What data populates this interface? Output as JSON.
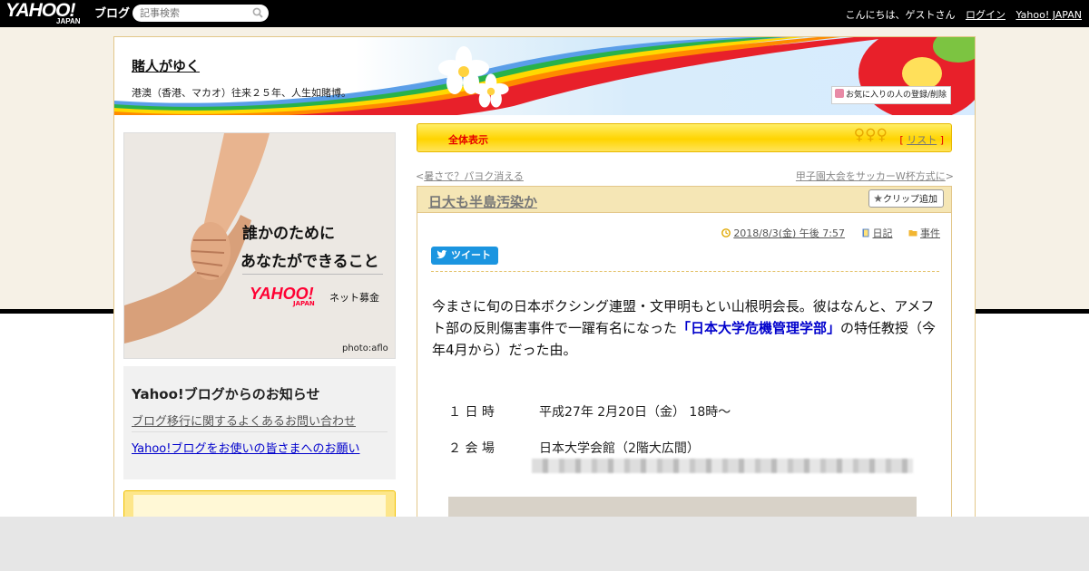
{
  "topbar": {
    "logo": "YAHOO!",
    "logo_sub": "JAPAN",
    "service": "ブログ",
    "search_placeholder": "記事検索",
    "greeting": "こんにちは、ゲストさん",
    "login": "ログイン",
    "yahoo_japan": "Yahoo! JAPAN"
  },
  "blog": {
    "title": "賭人がゆく",
    "description": "港澳（香港、マカオ）往来２５年、人生如賭博。",
    "favorite_button": "お気に入りの人の登録/削除"
  },
  "ad": {
    "line1": "誰かのために",
    "line2": "あなたができること",
    "logo": "YAHOO!",
    "logo_sub": "JAPAN",
    "service": "ネット募金",
    "credit": "photo:aflo"
  },
  "notice": {
    "title": "Yahoo!ブログからのお知らせ",
    "link1": "ブログ移行に関するよくあるお問い合わせ",
    "link2": "Yahoo!ブログをお使いの皆さまへのお願い"
  },
  "nav": {
    "show_all": "全体表示",
    "list_open": "[",
    "list": "リスト",
    "list_close": "]",
    "prev_arrow": "<",
    "prev": "暑さで？パヨク消える",
    "next": "甲子園大会をサッカーW杯方式に",
    "next_arrow": ">"
  },
  "article": {
    "title": "日大も半島汚染か",
    "clip_button": "クリップ追加",
    "date": "2018/8/3(金) 午後 7:57",
    "category1": "日記",
    "category2": "事件",
    "tweet": "ツイート",
    "body_part1": "今まさに旬の日本ボクシング連盟・文甲明もとい山根明会長。彼はなんと、アメフト部の反則傷害事件で一躍有名になった",
    "body_emphasis": "「日本大学危機管理学部」",
    "body_part2": "の特任教授（今年4月から）だった由。",
    "image_row1_label": "１ 日 時",
    "image_row1_value": "平成27年  2月20日（金）  18時〜",
    "image_row2_label": "２ 会 場",
    "image_row2_value": "日本大学会館（2階大広間）"
  },
  "colors": {
    "accent_red": "#e60000",
    "link_blue": "#0000cc",
    "tweet_blue": "#1b95e0",
    "yellow_bar": "#ffd400"
  }
}
